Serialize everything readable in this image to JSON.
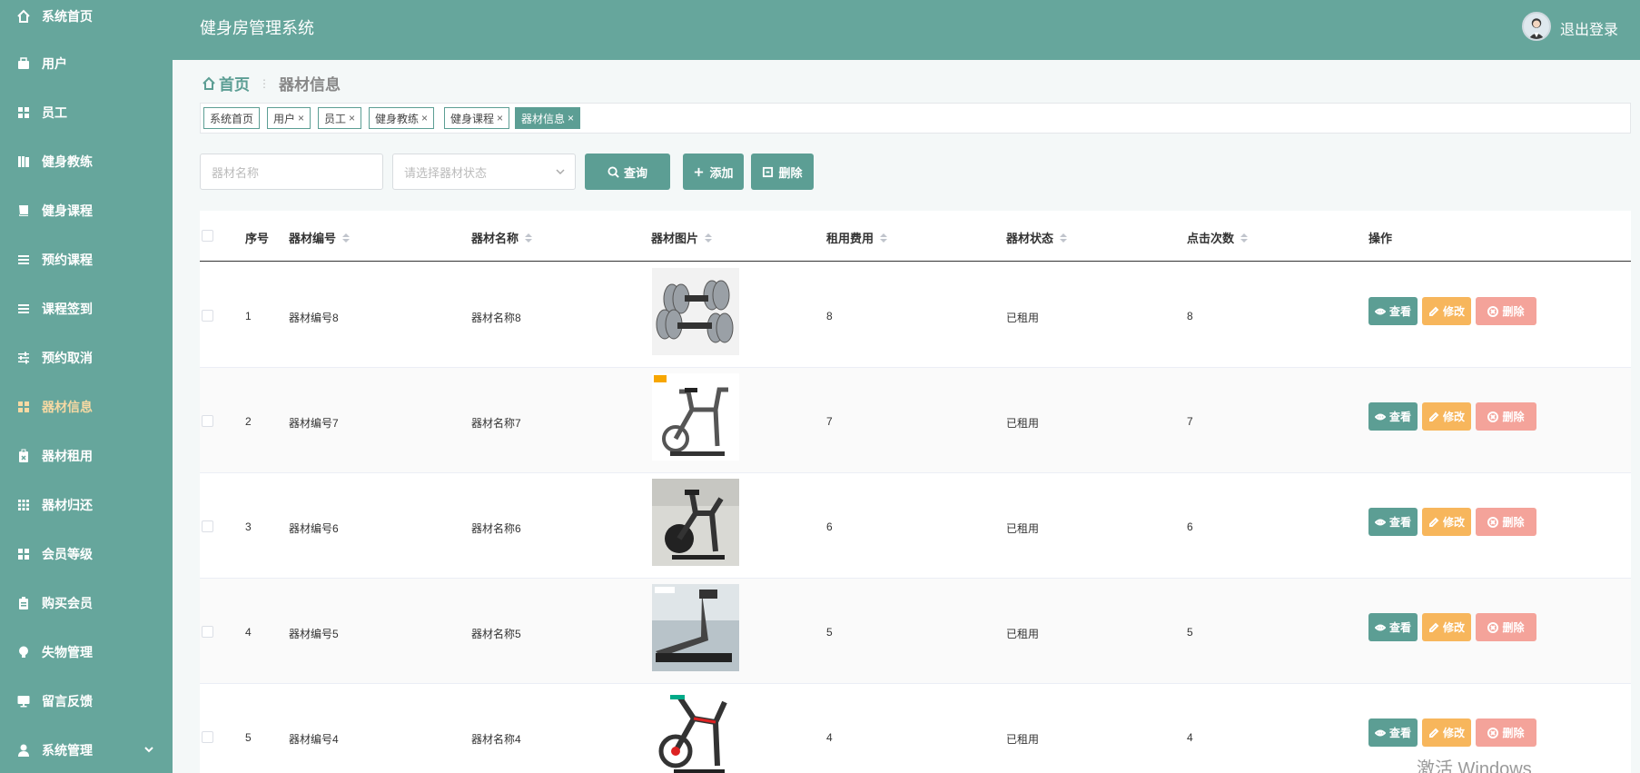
{
  "app": {
    "title": "健身房管理系统",
    "logout": "退出登录"
  },
  "sidebar": {
    "items": [
      {
        "label": "系统首页",
        "icon": "home-icon"
      },
      {
        "label": "用户",
        "icon": "briefcase-icon"
      },
      {
        "label": "员工",
        "icon": "grid-icon"
      },
      {
        "label": "健身教练",
        "icon": "books-icon"
      },
      {
        "label": "健身课程",
        "icon": "book-icon"
      },
      {
        "label": "预约课程",
        "icon": "list-icon"
      },
      {
        "label": "课程签到",
        "icon": "list-icon"
      },
      {
        "label": "预约取消",
        "icon": "sliders-icon"
      },
      {
        "label": "器材信息",
        "icon": "grid-icon",
        "active": true
      },
      {
        "label": "器材租用",
        "icon": "clipboard-x-icon"
      },
      {
        "label": "器材归还",
        "icon": "apps-icon"
      },
      {
        "label": "会员等级",
        "icon": "grid-icon"
      },
      {
        "label": "购买会员",
        "icon": "clipboard-icon"
      },
      {
        "label": "失物管理",
        "icon": "bulb-icon"
      },
      {
        "label": "留言反馈",
        "icon": "monitor-icon"
      },
      {
        "label": "系统管理",
        "icon": "user-icon"
      }
    ]
  },
  "breadcrumb": {
    "home": "首页",
    "separator": "⋮",
    "current": "器材信息"
  },
  "tags": [
    {
      "label": "系统首页",
      "closable": false
    },
    {
      "label": "用户",
      "closable": true
    },
    {
      "label": "员工",
      "closable": true
    },
    {
      "label": "健身教练",
      "closable": true
    },
    {
      "label": "健身课程",
      "closable": true
    },
    {
      "label": "器材信息",
      "closable": true,
      "active": true
    }
  ],
  "search": {
    "name_placeholder": "器材名称",
    "status_placeholder": "请选择器材状态",
    "query": "查询",
    "add": "添加",
    "delete": "删除"
  },
  "table": {
    "columns": [
      "序号",
      "器材编号",
      "器材名称",
      "器材图片",
      "租用费用",
      "器材状态",
      "点击次数",
      "操作"
    ],
    "rows": [
      {
        "index": "1",
        "code": "器材编号8",
        "name": "器材名称8",
        "image": "dumbbells",
        "fee": "8",
        "status": "已租用",
        "clicks": "8"
      },
      {
        "index": "2",
        "code": "器材编号7",
        "name": "器材名称7",
        "image": "spin-bike",
        "fee": "7",
        "status": "已租用",
        "clicks": "7"
      },
      {
        "index": "3",
        "code": "器材编号6",
        "name": "器材名称6",
        "image": "spin-bike-dark",
        "fee": "6",
        "status": "已租用",
        "clicks": "6"
      },
      {
        "index": "4",
        "code": "器材编号5",
        "name": "器材名称5",
        "image": "treadmill",
        "fee": "5",
        "status": "已租用",
        "clicks": "5"
      },
      {
        "index": "5",
        "code": "器材编号4",
        "name": "器材名称4",
        "image": "spin-bike-red",
        "fee": "4",
        "status": "已租用",
        "clicks": "4"
      }
    ],
    "actions": {
      "view": "查看",
      "edit": "修改",
      "delete": "删除"
    }
  },
  "watermark": "激活 Windows",
  "colors": {
    "primary": "#66a69c",
    "accent": "#f7d9a3",
    "edit": "#f7b65c",
    "delete": "#f4a39a"
  }
}
